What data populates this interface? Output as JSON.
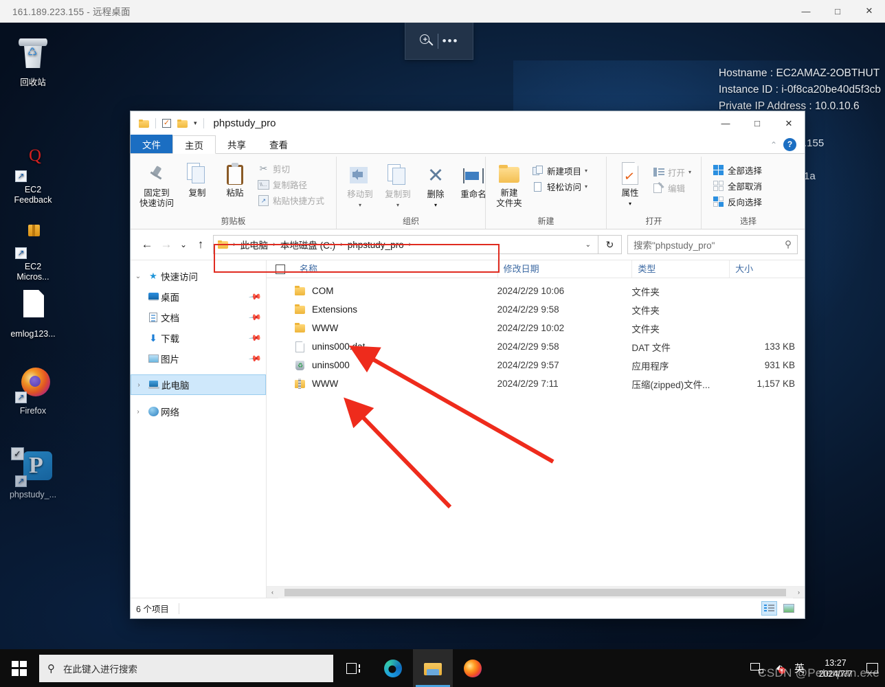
{
  "rdp": {
    "title": "161.189.223.155 - 远程桌面",
    "minimize": "—",
    "maximize": "□",
    "close": "✕",
    "connbar": {
      "zoom_label": "+",
      "more_label": "•••"
    }
  },
  "desktop": {
    "ec2_info": [
      "Hostname : EC2AMAZ-2OBTHUT",
      "Instance ID : i-0f8ca20be40d5f3cb",
      "Private IP Address : 10.0.10.6"
    ],
    "bg_text_1": ".155",
    "bg_text_2": "1a",
    "icons": [
      {
        "label": "回收站",
        "icon": "recycle-bin-icon"
      },
      {
        "label": "EC2\nFeedback",
        "icon": "ec2-feedback-icon"
      },
      {
        "label": "EC2\nMicros...",
        "icon": "ec2-microsoft-icon"
      },
      {
        "label": "emlog123...",
        "icon": "file-icon"
      },
      {
        "label": "Firefox",
        "icon": "firefox-icon"
      },
      {
        "label": "phpstudy_...",
        "icon": "phpstudy-icon"
      }
    ]
  },
  "explorer": {
    "title": "phpstudy_pro",
    "window_buttons": {
      "minimize": "—",
      "maximize": "□",
      "close": "✕"
    },
    "ribbon_collapse": "⌃",
    "help": "?",
    "tabs": [
      {
        "label": "文件",
        "kind": "file"
      },
      {
        "label": "主页",
        "kind": "active"
      },
      {
        "label": "共享",
        "kind": "normal"
      },
      {
        "label": "查看",
        "kind": "normal"
      }
    ],
    "ribbon": {
      "groups": [
        {
          "label": "剪贴板",
          "big": [
            {
              "label": "固定到\n快速访问",
              "icon": "pin-icon",
              "dim": false
            },
            {
              "label": "复制",
              "icon": "copy-icon",
              "dim": false
            },
            {
              "label": "粘贴",
              "icon": "paste-icon",
              "dim": false
            }
          ],
          "small": [
            {
              "label": "剪切",
              "icon": "scissors-icon",
              "dim": true
            },
            {
              "label": "复制路径",
              "icon": "copy-path-icon",
              "dim": true
            },
            {
              "label": "粘贴快捷方式",
              "icon": "paste-shortcut-icon",
              "dim": true
            }
          ]
        },
        {
          "label": "组织",
          "big": [
            {
              "label": "移动到",
              "icon": "move-to-icon",
              "dim": true,
              "caret": true
            },
            {
              "label": "复制到",
              "icon": "copy-to-icon",
              "dim": true,
              "caret": true
            },
            {
              "label": "删除",
              "icon": "delete-icon",
              "dim": false,
              "caret": true
            },
            {
              "label": "重命名",
              "icon": "rename-icon",
              "dim": false
            }
          ],
          "small": []
        },
        {
          "label": "新建",
          "big": [
            {
              "label": "新建\n文件夹",
              "icon": "new-folder-icon",
              "dim": false
            }
          ],
          "small": [
            {
              "label": "新建项目",
              "icon": "new-item-icon",
              "dim": false,
              "caret": true
            },
            {
              "label": "轻松访问",
              "icon": "easy-access-icon",
              "dim": false,
              "caret": true
            }
          ]
        },
        {
          "label": "打开",
          "big": [
            {
              "label": "属性",
              "icon": "properties-icon",
              "dim": false,
              "caret": true
            }
          ],
          "small": [
            {
              "label": "打开",
              "icon": "open-icon",
              "dim": true,
              "caret": true
            },
            {
              "label": "编辑",
              "icon": "edit-icon",
              "dim": true
            }
          ]
        },
        {
          "label": "选择",
          "big": [],
          "small": [
            {
              "label": "全部选择",
              "icon": "select-all-icon",
              "dim": false
            },
            {
              "label": "全部取消",
              "icon": "select-none-icon",
              "dim": false
            },
            {
              "label": "反向选择",
              "icon": "invert-selection-icon",
              "dim": false
            }
          ]
        }
      ]
    },
    "address": {
      "back": "←",
      "forward": "→",
      "recent": "⌄",
      "up": "↑",
      "crumbs": [
        "此电脑",
        "本地磁盘 (C:)",
        "phpstudy_pro"
      ],
      "separator": "›",
      "dropdown_caret": "⌄",
      "refresh": "↻"
    },
    "search": {
      "placeholder": "搜索\"phpstudy_pro\"",
      "icon": "search-icon"
    },
    "nav_pane": {
      "quick_access": {
        "label": "快速访问",
        "expander": "⌄",
        "icon": "star-icon"
      },
      "quick_items": [
        {
          "label": "桌面",
          "icon": "desktop-icon",
          "pinned": true
        },
        {
          "label": "文档",
          "icon": "documents-icon",
          "pinned": true
        },
        {
          "label": "下载",
          "icon": "downloads-icon",
          "pinned": true
        },
        {
          "label": "图片",
          "icon": "pictures-icon",
          "pinned": true
        }
      ],
      "this_pc": {
        "label": "此电脑",
        "expander": "›",
        "icon": "computer-icon",
        "selected": true
      },
      "network": {
        "label": "网络",
        "expander": "›",
        "icon": "network-icon"
      }
    },
    "columns": [
      "名称",
      "修改日期",
      "类型",
      "大小"
    ],
    "files": [
      {
        "name": "COM",
        "date": "2024/2/29 10:06",
        "type": "文件夹",
        "size": "",
        "icon": "folder-icon"
      },
      {
        "name": "Extensions",
        "date": "2024/2/29 9:58",
        "type": "文件夹",
        "size": "",
        "icon": "folder-icon"
      },
      {
        "name": "WWW",
        "date": "2024/2/29 10:02",
        "type": "文件夹",
        "size": "",
        "icon": "folder-icon"
      },
      {
        "name": "unins000.dat",
        "date": "2024/2/29 9:58",
        "type": "DAT 文件",
        "size": "133 KB",
        "icon": "dat-file-icon"
      },
      {
        "name": "unins000",
        "date": "2024/2/29 9:57",
        "type": "应用程序",
        "size": "931 KB",
        "icon": "application-icon"
      },
      {
        "name": "WWW",
        "date": "2024/2/29 7:11",
        "type": "压缩(zipped)文件...",
        "size": "1,157 KB",
        "icon": "zip-folder-icon"
      }
    ],
    "status": {
      "item_count": "6 个项目"
    },
    "view_buttons": [
      {
        "name": "details-view",
        "active": true
      },
      {
        "name": "large-icons-view",
        "active": false
      }
    ],
    "hscroll": {
      "left": "‹",
      "right": "›"
    }
  },
  "taskbar": {
    "start": "start-button",
    "search_placeholder": "在此键入进行搜索",
    "items": [
      {
        "name": "task-view",
        "active": false
      },
      {
        "name": "microsoft-edge",
        "active": false
      },
      {
        "name": "file-explorer",
        "active": true
      },
      {
        "name": "firefox",
        "active": false
      }
    ],
    "tray": {
      "ime": "英",
      "time": "13:27",
      "date": "2024/7/7"
    }
  },
  "watermark": "CSDN @Peterpan.exe",
  "colors": {
    "accent": "#1b6ec2",
    "annotation_red": "#e02b20",
    "selection": "#cfe8fb",
    "taskbar": "#0d0d0d"
  }
}
